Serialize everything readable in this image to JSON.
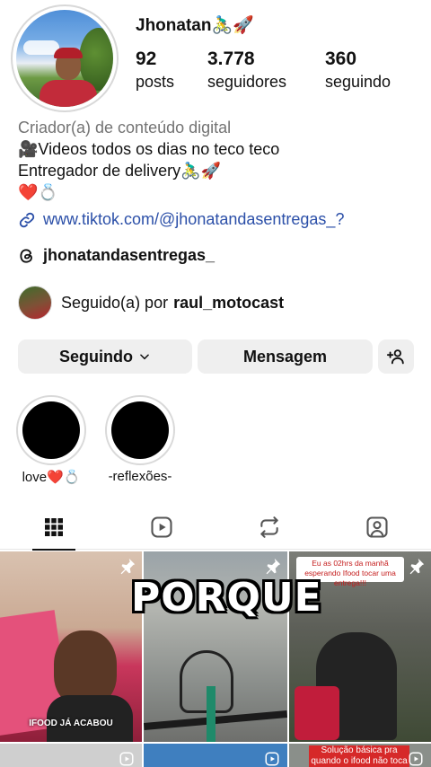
{
  "profile": {
    "name": "Jhonatan🚴‍♂️🚀",
    "posts_count": "92",
    "posts_label": "posts",
    "followers_count": "3.778",
    "followers_label": "seguidores",
    "following_count": "360",
    "following_label": "seguindo"
  },
  "bio": {
    "category": "Criador(a) de conteúdo digital",
    "line1": "🎥Videos todos os dias no teco teco",
    "line2": "Entregador de delivery🚴‍♂️🚀",
    "line3": "❤️💍",
    "link": "www.tiktok.com/@jhonatandasentregas_?",
    "threads": "jhonatandasentregas_"
  },
  "followed_by": {
    "prefix": "Seguido(a) por",
    "user": "raul_motocast"
  },
  "actions": {
    "following": "Seguindo",
    "message": "Mensagem"
  },
  "highlights": [
    {
      "label": "love❤️💍"
    },
    {
      "label": "-reflexões-"
    }
  ],
  "posts": [
    {
      "overlay_text": "IFOOD JÁ ACABOU"
    },
    {
      "overlay_text": "PORQUE"
    },
    {
      "overlay_text": "Eu as 02hrs da manhã esperando Ifood tocar uma entrega!!!"
    },
    {
      "overlay_text": "Solução básica pra quando o ifood não toca"
    }
  ],
  "colors": {
    "link": "#2b4fa8",
    "button_bg": "#efefef",
    "secondary_text": "#737373"
  }
}
